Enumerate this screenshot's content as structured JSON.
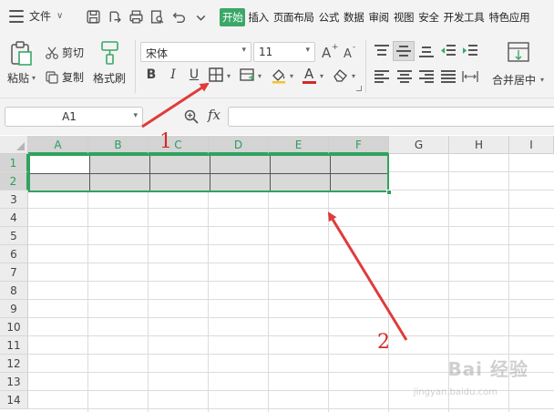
{
  "menubar": {
    "file_label": "文件",
    "tabs": [
      {
        "label": "开始",
        "active": true
      },
      {
        "label": "插入",
        "active": false
      },
      {
        "label": "页面布局",
        "active": false
      },
      {
        "label": "公式",
        "active": false
      },
      {
        "label": "数据",
        "active": false
      },
      {
        "label": "审阅",
        "active": false
      },
      {
        "label": "视图",
        "active": false
      },
      {
        "label": "安全",
        "active": false
      },
      {
        "label": "开发工具",
        "active": false
      },
      {
        "label": "特色应用",
        "active": false
      }
    ]
  },
  "ribbon": {
    "paste_label": "粘贴",
    "cut_label": "剪切",
    "copy_label": "复制",
    "format_painter_label": "格式刷",
    "font_name": "宋体",
    "font_size": "11",
    "bold": "B",
    "italic": "I",
    "underline": "U",
    "font_color_letter": "A",
    "merge_center_label": "合并居中"
  },
  "formula_bar": {
    "cell_ref": "A1",
    "fx_label": "fx",
    "formula_value": ""
  },
  "grid": {
    "columns": [
      {
        "label": "A",
        "selected": true
      },
      {
        "label": "B",
        "selected": true
      },
      {
        "label": "C",
        "selected": true
      },
      {
        "label": "D",
        "selected": true
      },
      {
        "label": "E",
        "selected": true
      },
      {
        "label": "F",
        "selected": true
      },
      {
        "label": "G",
        "selected": false
      },
      {
        "label": "H",
        "selected": false
      },
      {
        "label": "I",
        "selected": false
      }
    ],
    "rows": [
      {
        "label": "1",
        "selected": true
      },
      {
        "label": "2",
        "selected": true
      },
      {
        "label": "3",
        "selected": false
      },
      {
        "label": "4",
        "selected": false
      },
      {
        "label": "5",
        "selected": false
      },
      {
        "label": "6",
        "selected": false
      },
      {
        "label": "7",
        "selected": false
      },
      {
        "label": "8",
        "selected": false
      },
      {
        "label": "9",
        "selected": false
      },
      {
        "label": "10",
        "selected": false
      },
      {
        "label": "11",
        "selected": false
      },
      {
        "label": "12",
        "selected": false
      },
      {
        "label": "13",
        "selected": false
      },
      {
        "label": "14",
        "selected": false
      }
    ],
    "selection_range": "A1:F2"
  },
  "annotations": {
    "step1": "1",
    "step2": "2"
  },
  "watermark": {
    "main": "Bai 经验",
    "sub": "jingyan.baidu.com"
  },
  "colors": {
    "accent_green": "#3aa867",
    "annotation_red": "#d12a2a",
    "ribbon_bg": "#f3f3f3",
    "selection_fill": "#d9d9d9"
  }
}
